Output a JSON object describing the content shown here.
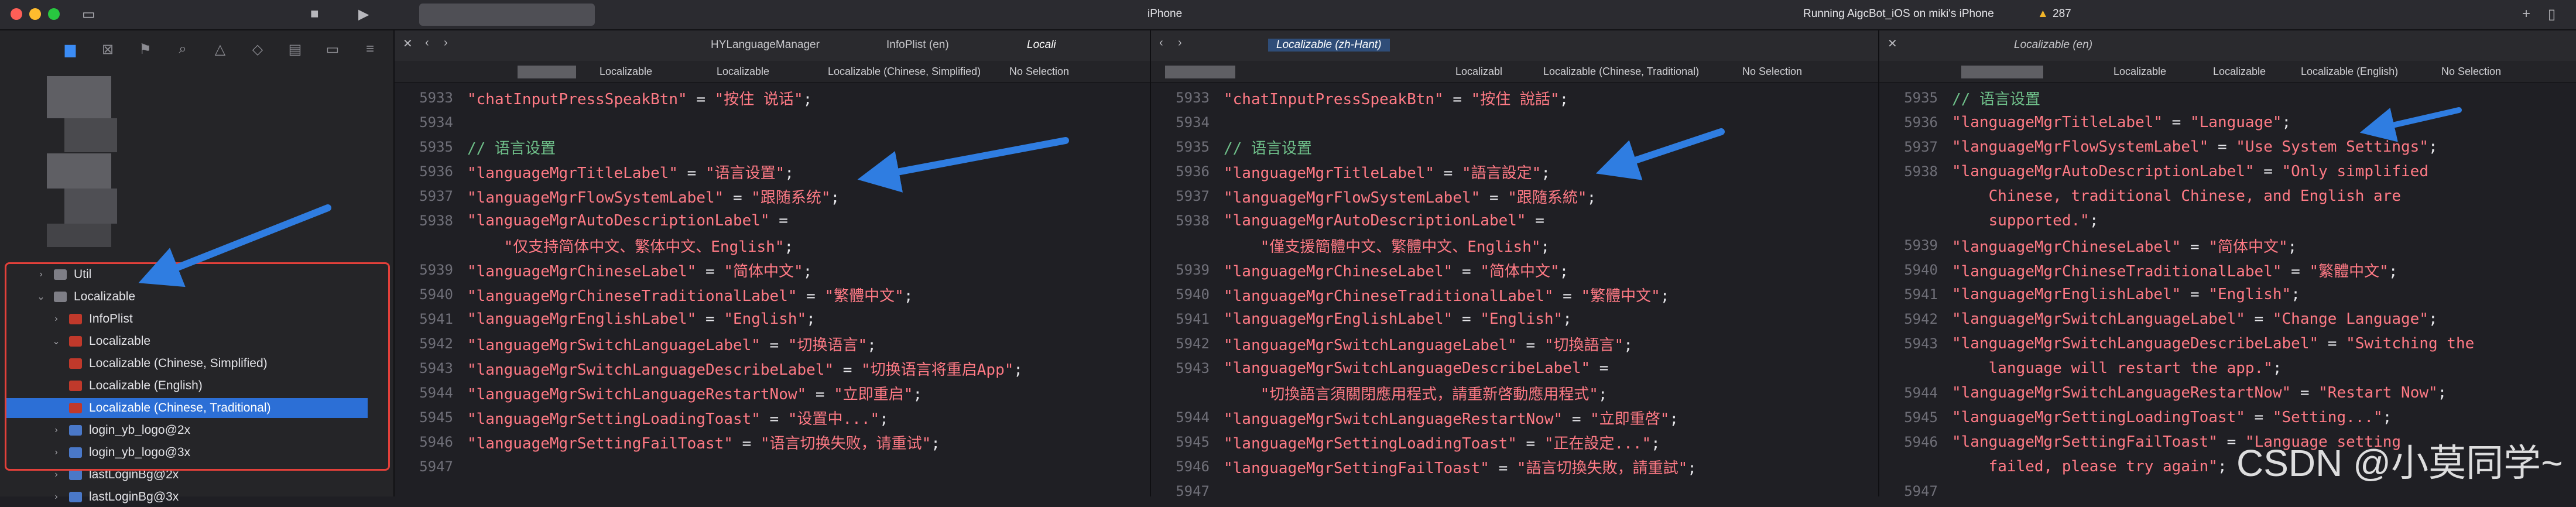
{
  "topbar": {
    "device": "iPhone",
    "run_status": "Running AigcBot_iOS on miki's iPhone",
    "warning_count": "287"
  },
  "sidebar": {
    "items": [
      {
        "label": "Util",
        "icon": "folder-icon",
        "chevron": "›",
        "indent": 0
      },
      {
        "label": "Localizable",
        "icon": "folder-icon",
        "chevron": "⌄",
        "indent": 0
      },
      {
        "label": "InfoPlist",
        "icon": "strings-file-icon",
        "chevron": "›",
        "indent": 1
      },
      {
        "label": "Localizable",
        "icon": "strings-file-icon",
        "chevron": "⌄",
        "indent": 1
      },
      {
        "label": "Localizable (Chinese, Simplified)",
        "icon": "strings-file-icon",
        "chevron": "",
        "indent": 2
      },
      {
        "label": "Localizable (English)",
        "icon": "strings-file-icon",
        "chevron": "",
        "indent": 2
      },
      {
        "label": "Localizable (Chinese, Traditional)",
        "icon": "strings-file-icon",
        "chevron": "",
        "indent": 2,
        "selected": true
      },
      {
        "label": "login_yb_logo@2x",
        "icon": "image-icon",
        "chevron": "›",
        "indent": 0
      },
      {
        "label": "login_yb_logo@3x",
        "icon": "image-icon",
        "chevron": "›",
        "indent": 0
      },
      {
        "label": "lastLoginBg@2x",
        "icon": "image-icon",
        "chevron": "›",
        "indent": 0
      },
      {
        "label": "lastLoginBg@3x",
        "icon": "image-icon",
        "chevron": "›",
        "indent": 0
      }
    ]
  },
  "pane1": {
    "tabs": [
      "HYLanguageManager",
      "InfoPlist (en)",
      "Locali"
    ],
    "breadcrumb": [
      "Localizable",
      "Localizable",
      "Localizable (Chinese, Simplified)",
      "No Selection"
    ],
    "lines": [
      {
        "num": "5933",
        "segs": [
          [
            "s",
            "\"chatInputPressSpeakBtn\""
          ],
          [
            "p",
            " = "
          ],
          [
            "s",
            "\"按住 说话\""
          ],
          [
            "p",
            ";"
          ]
        ]
      },
      {
        "num": "5934",
        "segs": []
      },
      {
        "num": "5935",
        "segs": [
          [
            "c",
            "// 语言设置"
          ]
        ]
      },
      {
        "num": "5936",
        "segs": [
          [
            "s",
            "\"languageMgrTitleLabel\""
          ],
          [
            "p",
            " = "
          ],
          [
            "s",
            "\"语言设置\""
          ],
          [
            "p",
            ";"
          ]
        ]
      },
      {
        "num": "5937",
        "segs": [
          [
            "s",
            "\"languageMgrFlowSystemLabel\""
          ],
          [
            "p",
            " = "
          ],
          [
            "s",
            "\"跟随系统\""
          ],
          [
            "p",
            ";"
          ]
        ]
      },
      {
        "num": "5938",
        "segs": [
          [
            "s",
            "\"languageMgrAutoDescriptionLabel\""
          ],
          [
            "p",
            " ="
          ]
        ]
      },
      {
        "num": "",
        "segs": [
          [
            "s",
            "    \"仅支持简体中文、繁体中文、English\""
          ],
          [
            "p",
            ";"
          ]
        ]
      },
      {
        "num": "5939",
        "segs": [
          [
            "s",
            "\"languageMgrChineseLabel\""
          ],
          [
            "p",
            " = "
          ],
          [
            "s",
            "\"简体中文\""
          ],
          [
            "p",
            ";"
          ]
        ]
      },
      {
        "num": "5940",
        "segs": [
          [
            "s",
            "\"languageMgrChineseTraditionalLabel\""
          ],
          [
            "p",
            " = "
          ],
          [
            "s",
            "\"繁體中文\""
          ],
          [
            "p",
            ";"
          ]
        ]
      },
      {
        "num": "5941",
        "segs": [
          [
            "s",
            "\"languageMgrEnglishLabel\""
          ],
          [
            "p",
            " = "
          ],
          [
            "s",
            "\"English\""
          ],
          [
            "p",
            ";"
          ]
        ]
      },
      {
        "num": "5942",
        "segs": [
          [
            "s",
            "\"languageMgrSwitchLanguageLabel\""
          ],
          [
            "p",
            " = "
          ],
          [
            "s",
            "\"切换语言\""
          ],
          [
            "p",
            ";"
          ]
        ]
      },
      {
        "num": "5943",
        "segs": [
          [
            "s",
            "\"languageMgrSwitchLanguageDescribeLabel\""
          ],
          [
            "p",
            " = "
          ],
          [
            "s",
            "\"切换语言将重启App\""
          ],
          [
            "p",
            ";"
          ]
        ]
      },
      {
        "num": "5944",
        "segs": [
          [
            "s",
            "\"languageMgrSwitchLanguageRestartNow\""
          ],
          [
            "p",
            " = "
          ],
          [
            "s",
            "\"立即重启\""
          ],
          [
            "p",
            ";"
          ]
        ]
      },
      {
        "num": "5945",
        "segs": [
          [
            "s",
            "\"languageMgrSettingLoadingToast\""
          ],
          [
            "p",
            " = "
          ],
          [
            "s",
            "\"设置中...\""
          ],
          [
            "p",
            ";"
          ]
        ]
      },
      {
        "num": "5946",
        "segs": [
          [
            "s",
            "\"languageMgrSettingFailToast\""
          ],
          [
            "p",
            " = "
          ],
          [
            "s",
            "\"语言切换失败，请重试\""
          ],
          [
            "p",
            ";"
          ]
        ]
      },
      {
        "num": "5947",
        "segs": []
      }
    ]
  },
  "pane2": {
    "tabs": [
      "Localizable (zh-Hant)"
    ],
    "breadcrumb": [
      "Localizabl",
      "Localizable (Chinese, Traditional)",
      "No Selection"
    ],
    "lines": [
      {
        "num": "5933",
        "segs": [
          [
            "s",
            "\"chatInputPressSpeakBtn\""
          ],
          [
            "p",
            " = "
          ],
          [
            "s",
            "\"按住 說話\""
          ],
          [
            "p",
            ";"
          ]
        ]
      },
      {
        "num": "5934",
        "segs": []
      },
      {
        "num": "5935",
        "segs": [
          [
            "c",
            "// 语言设置"
          ]
        ]
      },
      {
        "num": "5936",
        "segs": [
          [
            "s",
            "\"languageMgrTitleLabel\""
          ],
          [
            "p",
            " = "
          ],
          [
            "s",
            "\"語言設定\""
          ],
          [
            "p",
            ";"
          ]
        ]
      },
      {
        "num": "5937",
        "segs": [
          [
            "s",
            "\"languageMgrFlowSystemLabel\""
          ],
          [
            "p",
            " = "
          ],
          [
            "s",
            "\"跟隨系統\""
          ],
          [
            "p",
            ";"
          ]
        ]
      },
      {
        "num": "5938",
        "segs": [
          [
            "s",
            "\"languageMgrAutoDescriptionLabel\""
          ],
          [
            "p",
            " ="
          ]
        ]
      },
      {
        "num": "",
        "segs": [
          [
            "s",
            "    \"僅支援簡體中文、繁體中文、English\""
          ],
          [
            "p",
            ";"
          ]
        ]
      },
      {
        "num": "5939",
        "segs": [
          [
            "s",
            "\"languageMgrChineseLabel\""
          ],
          [
            "p",
            " = "
          ],
          [
            "s",
            "\"简体中文\""
          ],
          [
            "p",
            ";"
          ]
        ]
      },
      {
        "num": "5940",
        "segs": [
          [
            "s",
            "\"languageMgrChineseTraditionalLabel\""
          ],
          [
            "p",
            " = "
          ],
          [
            "s",
            "\"繁體中文\""
          ],
          [
            "p",
            ";"
          ]
        ]
      },
      {
        "num": "5941",
        "segs": [
          [
            "s",
            "\"languageMgrEnglishLabel\""
          ],
          [
            "p",
            " = "
          ],
          [
            "s",
            "\"English\""
          ],
          [
            "p",
            ";"
          ]
        ]
      },
      {
        "num": "5942",
        "segs": [
          [
            "s",
            "\"languageMgrSwitchLanguageLabel\""
          ],
          [
            "p",
            " = "
          ],
          [
            "s",
            "\"切換語言\""
          ],
          [
            "p",
            ";"
          ]
        ]
      },
      {
        "num": "5943",
        "segs": [
          [
            "s",
            "\"languageMgrSwitchLanguageDescribeLabel\""
          ],
          [
            "p",
            " ="
          ]
        ]
      },
      {
        "num": "",
        "segs": [
          [
            "s",
            "    \"切換語言須關閉應用程式，請重新啓動應用程式\""
          ],
          [
            "p",
            ";"
          ]
        ]
      },
      {
        "num": "5944",
        "segs": [
          [
            "s",
            "\"languageMgrSwitchLanguageRestartNow\""
          ],
          [
            "p",
            " = "
          ],
          [
            "s",
            "\"立即重啓\""
          ],
          [
            "p",
            ";"
          ]
        ]
      },
      {
        "num": "5945",
        "segs": [
          [
            "s",
            "\"languageMgrSettingLoadingToast\""
          ],
          [
            "p",
            " = "
          ],
          [
            "s",
            "\"正在設定...\""
          ],
          [
            "p",
            ";"
          ]
        ]
      },
      {
        "num": "5946",
        "segs": [
          [
            "s",
            "\"languageMgrSettingFailToast\""
          ],
          [
            "p",
            " = "
          ],
          [
            "s",
            "\"語言切換失敗，請重試\""
          ],
          [
            "p",
            ";"
          ]
        ]
      },
      {
        "num": "5947",
        "segs": []
      }
    ]
  },
  "pane3": {
    "tabs": [
      "Localizable (en)"
    ],
    "breadcrumb": [
      "Localizable",
      "Localizable",
      "Localizable (English)",
      "No Selection"
    ],
    "lines": [
      {
        "num": "5935",
        "segs": [
          [
            "c",
            "// 语言设置"
          ]
        ]
      },
      {
        "num": "5936",
        "segs": [
          [
            "s",
            "\"languageMgrTitleLabel\""
          ],
          [
            "p",
            " = "
          ],
          [
            "s",
            "\"Language\""
          ],
          [
            "p",
            ";"
          ]
        ]
      },
      {
        "num": "5937",
        "segs": [
          [
            "s",
            "\"languageMgrFlowSystemLabel\""
          ],
          [
            "p",
            " = "
          ],
          [
            "s",
            "\"Use System Settings\""
          ],
          [
            "p",
            ";"
          ]
        ]
      },
      {
        "num": "5938",
        "segs": [
          [
            "s",
            "\"languageMgrAutoDescriptionLabel\""
          ],
          [
            "p",
            " = "
          ],
          [
            "s",
            "\"Only simplified"
          ]
        ]
      },
      {
        "num": "",
        "segs": [
          [
            "s",
            "    Chinese, traditional Chinese, and English are"
          ]
        ]
      },
      {
        "num": "",
        "segs": [
          [
            "s",
            "    supported.\""
          ],
          [
            "p",
            ";"
          ]
        ]
      },
      {
        "num": "5939",
        "segs": [
          [
            "s",
            "\"languageMgrChineseLabel\""
          ],
          [
            "p",
            " = "
          ],
          [
            "s",
            "\"简体中文\""
          ],
          [
            "p",
            ";"
          ]
        ]
      },
      {
        "num": "5940",
        "segs": [
          [
            "s",
            "\"languageMgrChineseTraditionalLabel\""
          ],
          [
            "p",
            " = "
          ],
          [
            "s",
            "\"繁體中文\""
          ],
          [
            "p",
            ";"
          ]
        ]
      },
      {
        "num": "5941",
        "segs": [
          [
            "s",
            "\"languageMgrEnglishLabel\""
          ],
          [
            "p",
            " = "
          ],
          [
            "s",
            "\"English\""
          ],
          [
            "p",
            ";"
          ]
        ]
      },
      {
        "num": "5942",
        "segs": [
          [
            "s",
            "\"languageMgrSwitchLanguageLabel\""
          ],
          [
            "p",
            " = "
          ],
          [
            "s",
            "\"Change Language\""
          ],
          [
            "p",
            ";"
          ]
        ]
      },
      {
        "num": "5943",
        "segs": [
          [
            "s",
            "\"languageMgrSwitchLanguageDescribeLabel\""
          ],
          [
            "p",
            " = "
          ],
          [
            "s",
            "\"Switching the"
          ]
        ]
      },
      {
        "num": "",
        "segs": [
          [
            "s",
            "    language will restart the app.\""
          ],
          [
            "p",
            ";"
          ]
        ]
      },
      {
        "num": "5944",
        "segs": [
          [
            "s",
            "\"languageMgrSwitchLanguageRestartNow\""
          ],
          [
            "p",
            " = "
          ],
          [
            "s",
            "\"Restart Now\""
          ],
          [
            "p",
            ";"
          ]
        ]
      },
      {
        "num": "5945",
        "segs": [
          [
            "s",
            "\"languageMgrSettingLoadingToast\""
          ],
          [
            "p",
            " = "
          ],
          [
            "s",
            "\"Setting...\""
          ],
          [
            "p",
            ";"
          ]
        ]
      },
      {
        "num": "5946",
        "segs": [
          [
            "s",
            "\"languageMgrSettingFailToast\""
          ],
          [
            "p",
            " = "
          ],
          [
            "s",
            "\"Language setting"
          ]
        ]
      },
      {
        "num": "",
        "segs": [
          [
            "s",
            "    failed, please try again\""
          ],
          [
            "p",
            ";"
          ]
        ]
      },
      {
        "num": "5947",
        "segs": []
      }
    ]
  },
  "watermark": "CSDN @小莫同学~",
  "colors": {
    "accent": "#2c6fd6",
    "string": "#ff7a85",
    "comment": "#6fc08a",
    "annotation": "#e4403a",
    "arrow": "#2f7de1"
  }
}
